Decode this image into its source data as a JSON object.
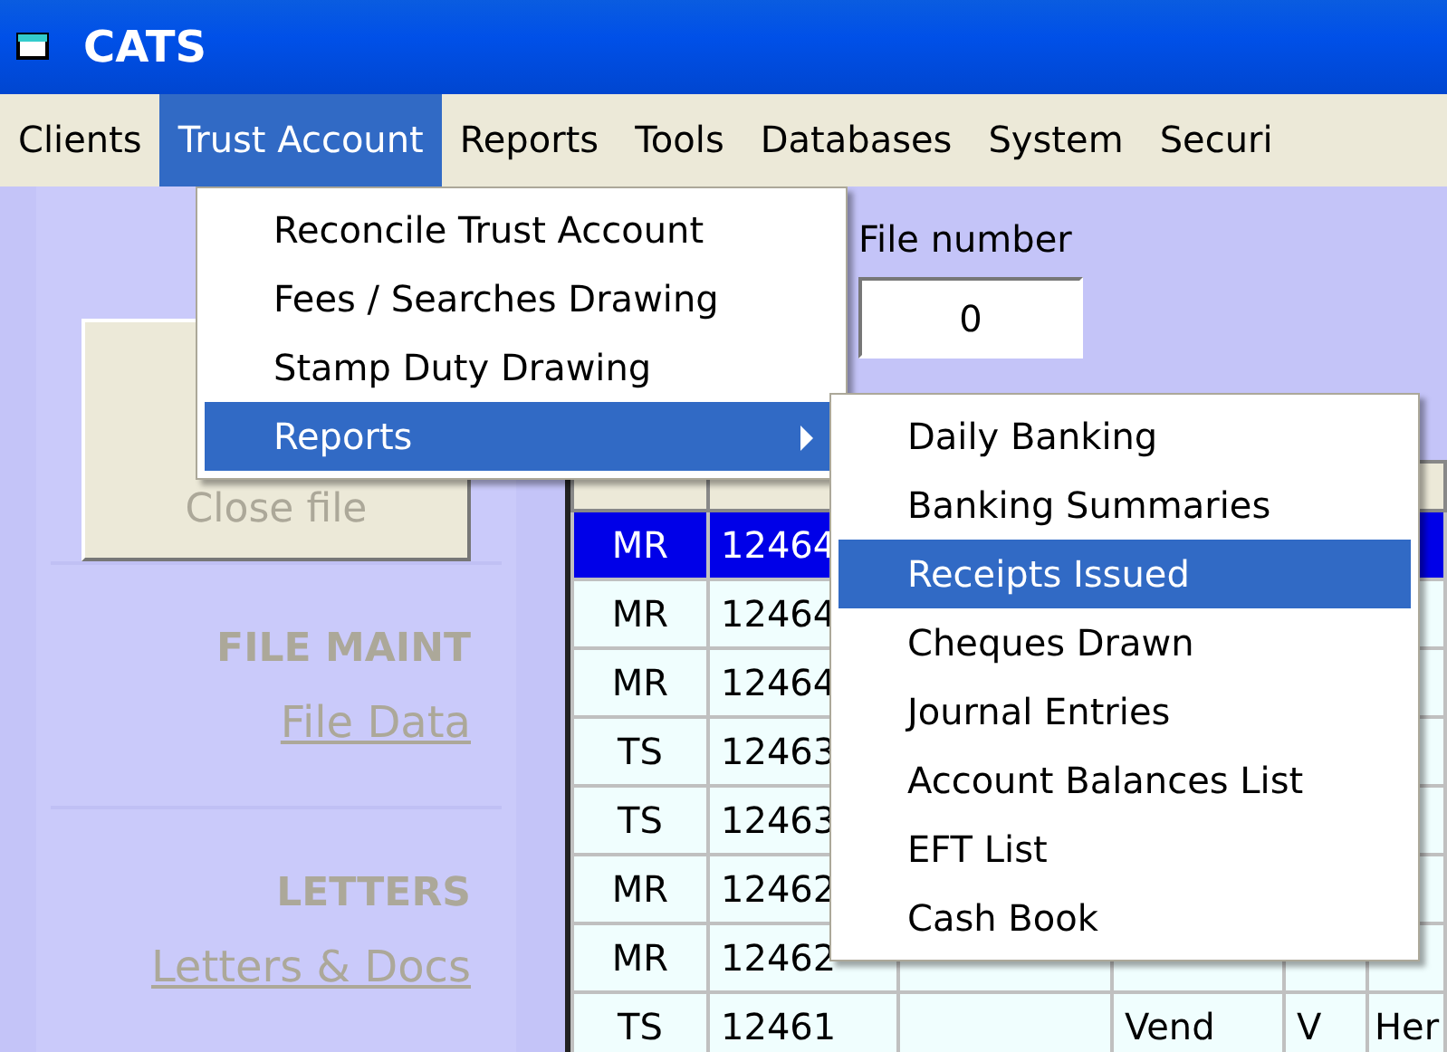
{
  "window": {
    "title": "CATS"
  },
  "menu_bar": [
    {
      "label": "Clients",
      "selected": false
    },
    {
      "label": "Trust Account",
      "selected": true
    },
    {
      "label": "Reports",
      "selected": false
    },
    {
      "label": "Tools",
      "selected": false
    },
    {
      "label": "Databases",
      "selected": false
    },
    {
      "label": "System",
      "selected": false
    },
    {
      "label": "Securi",
      "selected": false
    }
  ],
  "dropdown": [
    {
      "label": "Reconcile Trust Account",
      "selected": false,
      "submenu": false
    },
    {
      "label": "Fees / Searches Drawing",
      "selected": false,
      "submenu": false
    },
    {
      "label": "Stamp Duty Drawing",
      "selected": false,
      "submenu": false
    },
    {
      "label": "Reports",
      "selected": true,
      "submenu": true
    }
  ],
  "submenu": [
    {
      "label": "Daily Banking",
      "selected": false
    },
    {
      "label": "Banking Summaries",
      "selected": false
    },
    {
      "label": "Receipts Issued",
      "selected": true
    },
    {
      "label": "Cheques Drawn",
      "selected": false
    },
    {
      "label": "Journal Entries",
      "selected": false
    },
    {
      "label": "Account Balances List",
      "selected": false
    },
    {
      "label": "EFT List",
      "selected": false
    },
    {
      "label": "Cash Book",
      "selected": false
    }
  ],
  "sidebar": {
    "button": {
      "label": "Close file",
      "disabled": true
    },
    "sections": [
      {
        "heading": "FILE MAINT",
        "link": "File Data",
        "disabled": true
      },
      {
        "heading": "LETTERS",
        "link": "Letters & Docs",
        "disabled": true
      }
    ]
  },
  "file_number": {
    "label": "File number",
    "value": "0"
  },
  "table": {
    "rows": [
      {
        "selected": true,
        "column_1": "MR",
        "column_2": "12464"
      },
      {
        "selected": false,
        "column_1": "MR",
        "column_2": "12464"
      },
      {
        "selected": false,
        "column_1": "MR",
        "column_2": "12464"
      },
      {
        "selected": false,
        "column_1": "TS",
        "column_2": "12463"
      },
      {
        "selected": false,
        "column_1": "TS",
        "column_2": "12463"
      },
      {
        "selected": false,
        "column_1": "MR",
        "column_2": "12462"
      },
      {
        "selected": false,
        "column_1": "MR",
        "column_2": "12462"
      },
      {
        "selected": false,
        "column_1": "TS",
        "column_2": "12461",
        "column_4": "Vend",
        "column_5": "V",
        "column_6": "Her"
      }
    ]
  }
}
